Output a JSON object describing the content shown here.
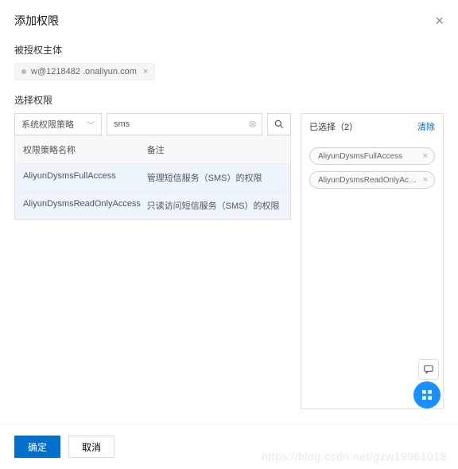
{
  "modal": {
    "title": "添加权限",
    "close": "×"
  },
  "principal": {
    "label": "被授权主体",
    "value": "w@1218482          .onaliyun.com",
    "remove": "×"
  },
  "select_permission_label": "选择权限",
  "policy_select": {
    "label": "系统权限策略"
  },
  "search": {
    "value": "sms"
  },
  "table": {
    "headers": {
      "name": "权限策略名称",
      "note": "备注"
    },
    "rows": [
      {
        "name": "AliyunDysmsFullAccess",
        "note": "管理短信服务（SMS）的权限"
      },
      {
        "name": "AliyunDysmsReadOnlyAccess",
        "note": "只读访问短信服务（SMS）的权限"
      }
    ]
  },
  "selected": {
    "header": "已选择（2）",
    "clear": "清除",
    "items": [
      "AliyunDysmsFullAccess",
      "AliyunDysmsReadOnlyAccess"
    ]
  },
  "footer": {
    "ok": "确定",
    "cancel": "取消"
  },
  "watermark": "https://blog.csdn.net/gzw19961018"
}
